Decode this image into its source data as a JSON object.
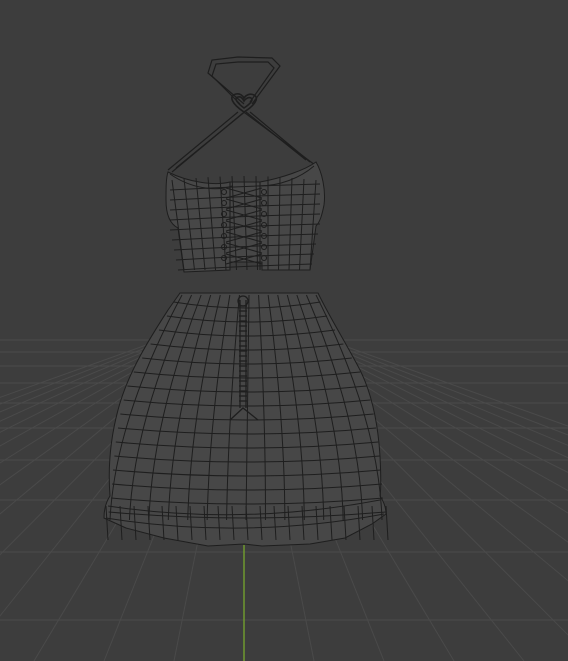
{
  "viewport": {
    "background_color": "#3d3d3d",
    "grid_color": "#4a4a4a",
    "axis_y_color": "#6f9a2e",
    "wire_color": "#1e1e1e",
    "mesh_fill_color": "#474747"
  },
  "scene": {
    "objects": [
      {
        "name": "halter-strap",
        "type": "mesh"
      },
      {
        "name": "heart-charm",
        "type": "mesh"
      },
      {
        "name": "crop-top",
        "type": "mesh"
      },
      {
        "name": "corset-lacing",
        "type": "mesh"
      },
      {
        "name": "skirt",
        "type": "mesh"
      },
      {
        "name": "skirt-zipper",
        "type": "mesh"
      }
    ]
  }
}
